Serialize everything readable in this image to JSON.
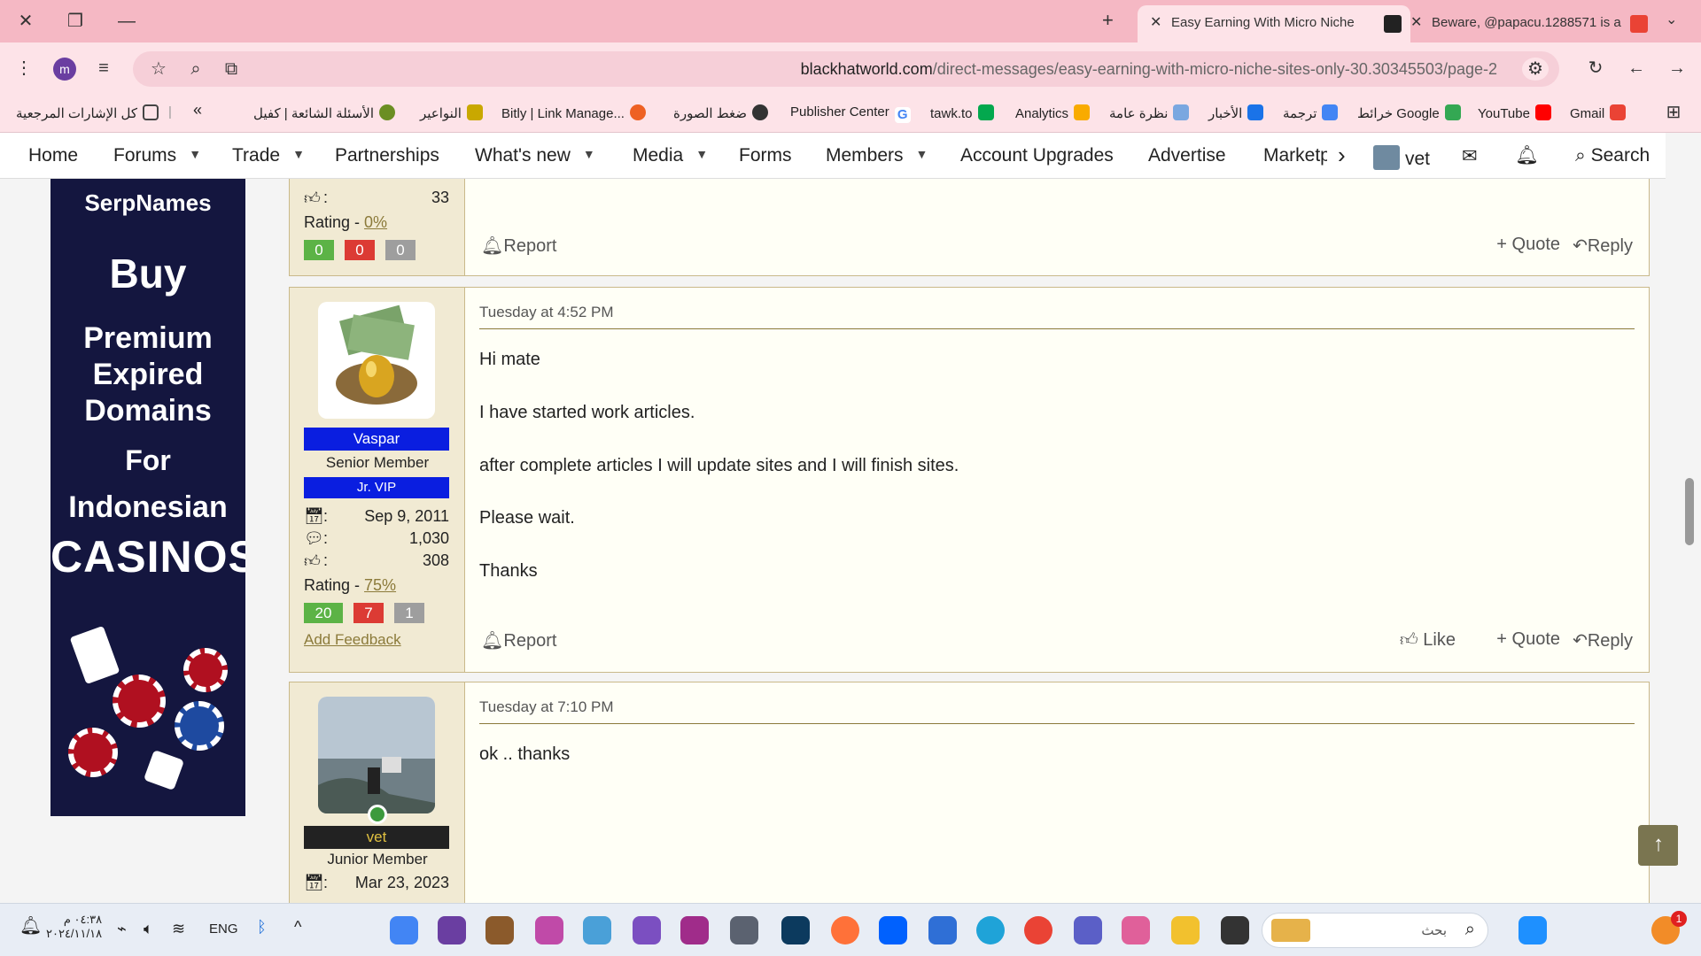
{
  "browser": {
    "tabs": [
      {
        "title": "Easy Earning With Micro Niche",
        "active": true
      },
      {
        "title": "Beware, @papacu.1288571 is a",
        "active": false
      }
    ],
    "url_domain": "blackhatworld.com",
    "url_path": "/direct-messages/easy-earning-with-micro-niche-sites-only-30.30345503/page-2",
    "profile_initial": "m",
    "bookmarks": [
      "Gmail",
      "YouTube",
      "خرائط Google",
      "ترجمة",
      "الأخبار",
      "نظرة عامة",
      "Analytics",
      "tawk.to",
      "Publisher Center",
      "ضغط الصورة",
      "Bitly | Link Manage...",
      "النواعير",
      "الأسئلة الشائعة | كفيل",
      "كل الإشارات المرجعية"
    ]
  },
  "nav": {
    "home": "Home",
    "forums": "Forums",
    "trade": "Trade",
    "partnerships": "Partnerships",
    "whats_new": "What's new",
    "media": "Media",
    "forms": "Forms",
    "members": "Members",
    "account_upgrades": "Account Upgrades",
    "advertise": "Advertise",
    "marketplace": "Marketp",
    "user": "vet",
    "search": "Search"
  },
  "ad": {
    "brand": "SerpNames",
    "line1": "Buy",
    "line2a": "Premium",
    "line2b": "Expired",
    "line2c": "Domains",
    "line3": "For",
    "line4": "Indonesian",
    "line5": "CASINOS"
  },
  "posts": [
    {
      "partial_top": true,
      "stat_likes": "33",
      "rating_label": "Rating - ",
      "rating_value": "0%",
      "ratings": [
        "0",
        "0",
        "0"
      ],
      "actions": {
        "report": "Report",
        "quote": "Quote",
        "reply": "Reply"
      }
    },
    {
      "username": "Vaspar",
      "user_title": "Senior Member",
      "badge": "Jr. VIP",
      "joined": "Sep 9, 2011",
      "messages": "1,030",
      "likes": "308",
      "rating_label": "Rating - ",
      "rating_value": "75%",
      "ratings": [
        "20",
        "7",
        "1"
      ],
      "feedback": "Add Feedback",
      "date": "Tuesday at 4:52 PM",
      "lines": [
        "Hi mate",
        "I have started work articles.",
        "after complete articles I will update sites and I will finish sites.",
        "Please wait.",
        "Thanks"
      ],
      "actions": {
        "report": "Report",
        "like": "Like",
        "quote": "Quote",
        "reply": "Reply"
      }
    },
    {
      "username": "vet",
      "user_title": "Junior Member",
      "joined": "Mar 23, 2023",
      "date": "Tuesday at 7:10 PM",
      "lines": [
        "ok .. thanks"
      ]
    }
  ],
  "taskbar": {
    "time": "٠٤:٣٨ م",
    "date": "٢٠٢٤/١١/١٨",
    "lang": "ENG",
    "search_placeholder": "بحث",
    "notif_count": "1"
  },
  "colors": {
    "tabstrip": "#f5b8c4",
    "toolbar": "#fde3e8",
    "user_panel": "#f1ead3",
    "accent": "#8b7a3a",
    "badge_blue": "#0a1ee0",
    "rating_green": "#5cb346",
    "rating_red": "#dc3b34",
    "rating_grey": "#9e9e9e"
  }
}
